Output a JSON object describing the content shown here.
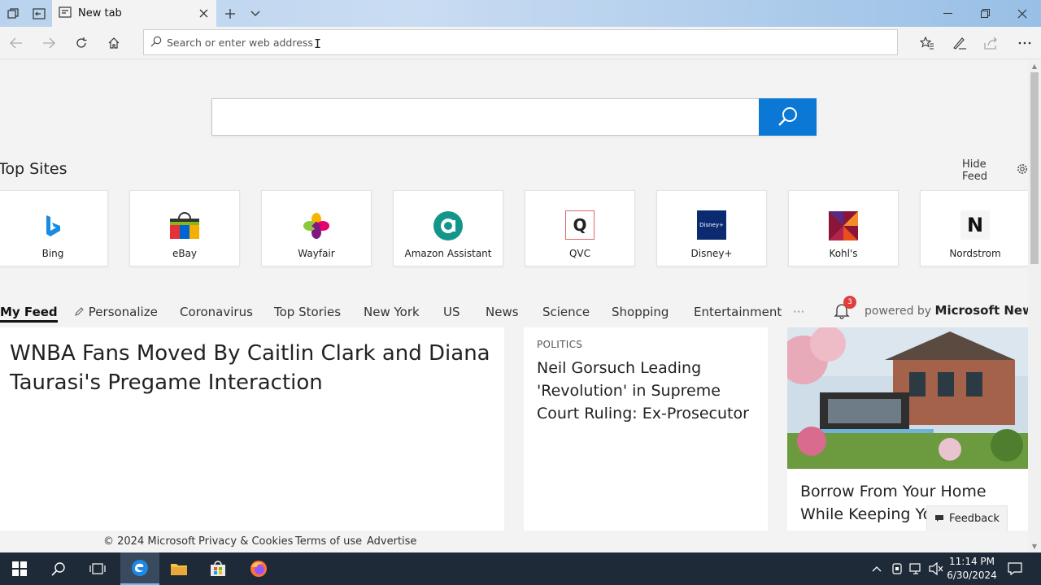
{
  "tab": {
    "title": "New tab"
  },
  "address": {
    "placeholder": "Search or enter web address"
  },
  "top_sites": {
    "title": "Top Sites",
    "hide_feed": "Hide Feed",
    "tiles": [
      {
        "label": "Bing",
        "icon": "bing-logo"
      },
      {
        "label": "eBay",
        "icon": "ebay-logo"
      },
      {
        "label": "Wayfair",
        "icon": "wayfair-logo"
      },
      {
        "label": "Amazon Assistant",
        "icon": "amazon-assistant-logo"
      },
      {
        "label": "QVC",
        "icon": "qvc-logo",
        "glyph": "Q"
      },
      {
        "label": "Disney+",
        "icon": "disney-plus-logo",
        "glyph": "Disney+"
      },
      {
        "label": "Kohl's",
        "icon": "kohls-logo"
      },
      {
        "label": "Nordstrom",
        "icon": "nordstrom-logo",
        "glyph": "N"
      }
    ]
  },
  "feed_nav": {
    "items": [
      "My Feed",
      "Personalize",
      "Coronavirus",
      "Top Stories",
      "New York",
      "US",
      "News",
      "Science",
      "Shopping",
      "Entertainment"
    ],
    "more": "···",
    "notification_count": "3",
    "powered_prefix": "powered by",
    "powered_brand": "Microsoft News"
  },
  "cards": [
    {
      "headline": "WNBA Fans Moved By Caitlin Clark and Diana Taurasi's Pregame Interaction"
    },
    {
      "category": "POLITICS",
      "headline": "Neil Gorsuch Leading 'Revolution' in Supreme Court Ruling: Ex-Prosecutor"
    },
    {
      "line1": "Borrow From Your Home",
      "line2": "While Keeping Yo"
    }
  ],
  "footer": {
    "copyright": "© 2024 Microsoft",
    "privacy": "Privacy & Cookies",
    "terms": "Terms of use",
    "advertise": "Advertise",
    "feedback": "Feedback"
  },
  "taskbar": {
    "time": "11:14 PM",
    "date": "6/30/2024"
  },
  "colors": {
    "accent": "#0a78d4",
    "taskbar": "#1f2a38",
    "badge": "#e03e3e"
  }
}
